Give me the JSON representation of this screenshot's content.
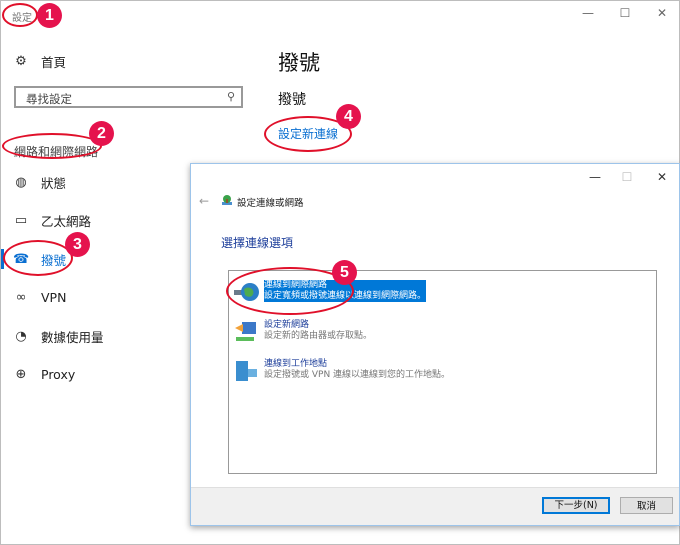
{
  "settings_window": {
    "app_title": "設定",
    "window_controls": {
      "minimize": "—",
      "maximize": "☐",
      "close": "✕"
    },
    "home_label": "首頁",
    "search": {
      "placeholder": "尋找設定"
    },
    "section_label": "網路和網際網路",
    "nav_items": [
      {
        "label": "狀態",
        "icon": "globe-monitor-icon",
        "glyph": "◍"
      },
      {
        "label": "乙太網路",
        "icon": "ethernet-icon",
        "glyph": "▭"
      },
      {
        "label": "撥號",
        "icon": "dialup-icon",
        "glyph": "☎",
        "active": true
      },
      {
        "label": "VPN",
        "icon": "vpn-icon",
        "glyph": "∞"
      },
      {
        "label": "數據使用量",
        "icon": "data-usage-icon",
        "glyph": "◔"
      },
      {
        "label": "Proxy",
        "icon": "globe-icon",
        "glyph": "⊕"
      }
    ],
    "page_title": "撥號",
    "sub_title": "撥號",
    "setup_link": "設定新連線"
  },
  "dialog": {
    "title": "設定連線或網路",
    "heading": "選擇連線選項",
    "window_controls": {
      "minimize": "—",
      "maximize": "☐",
      "close": "✕"
    },
    "back_glyph": "←",
    "options": [
      {
        "title": "連線到網際網路",
        "desc": "設定寬頻或撥號連線以連線到網際網路。",
        "selected": true
      },
      {
        "title": "設定新網路",
        "desc": "設定新的路由器或存取點。",
        "selected": false
      },
      {
        "title": "連線到工作地點",
        "desc": "設定撥號或 VPN 連線以連線到您的工作地點。",
        "selected": false
      }
    ],
    "buttons": {
      "next": "下一步(N)",
      "cancel": "取消"
    }
  },
  "annotations": [
    "1",
    "2",
    "3",
    "4",
    "5"
  ],
  "colors": {
    "accent": "#0a6fd1",
    "annotation_red": "#e5134d",
    "selection": "#0078d7"
  }
}
